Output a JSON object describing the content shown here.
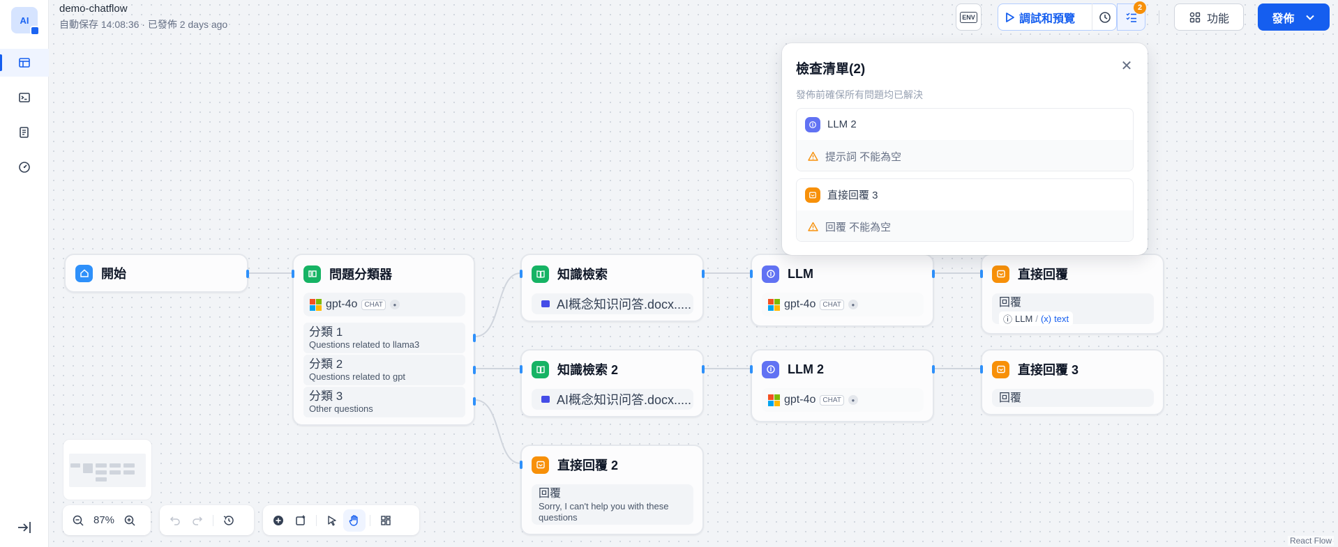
{
  "header": {
    "app_name": "demo-chatflow",
    "save_status": "自動保存 14:08:36 · 已發佈 2 days ago",
    "env_label": "ENV",
    "run_label": "調試和預覽",
    "checklist_count": "2",
    "features_label": "功能",
    "publish_label": "發佈"
  },
  "sidebar": {
    "logo_text": "AI",
    "items": [
      {
        "name": "orchestrate",
        "icon": "layout-icon"
      },
      {
        "name": "api-access",
        "icon": "terminal-icon"
      },
      {
        "name": "logs",
        "icon": "file-list-icon"
      },
      {
        "name": "monitoring",
        "icon": "dashboard-icon"
      }
    ]
  },
  "checklist": {
    "title": "檢查清單(2)",
    "subtitle": "發佈前確保所有問題均已解決",
    "issues": [
      {
        "node": "LLM 2",
        "message": "提示詞 不能為空",
        "color": "#6172f3"
      },
      {
        "node": "直接回覆 3",
        "message": "回覆 不能為空",
        "color": "#f79009"
      }
    ]
  },
  "nodes": {
    "start": {
      "title": "開始"
    },
    "classifier": {
      "title": "問題分類器",
      "model": "gpt-4o",
      "model_tag": "CHAT",
      "classes": [
        {
          "name": "分類 1",
          "desc": "Questions related to llama3"
        },
        {
          "name": "分類 2",
          "desc": "Questions related to gpt"
        },
        {
          "name": "分類 3",
          "desc": "Other questions"
        }
      ]
    },
    "kr1": {
      "title": "知識檢索",
      "dataset": "AI概念知识问答.docx....."
    },
    "kr2": {
      "title": "知識檢索 2",
      "dataset": "AI概念知识问答.docx....."
    },
    "llm1": {
      "title": "LLM",
      "model": "gpt-4o",
      "model_tag": "CHAT"
    },
    "llm2": {
      "title": "LLM 2",
      "model": "gpt-4o",
      "model_tag": "CHAT"
    },
    "answer1": {
      "title": "直接回覆",
      "label": "回覆",
      "var_node": "LLM",
      "var_sep": "/",
      "var_name": "text"
    },
    "answer2": {
      "title": "直接回覆 2",
      "label": "回覆",
      "text": "Sorry, I can't help you with these questions"
    },
    "answer3": {
      "title": "直接回覆 3",
      "label": "回覆"
    }
  },
  "controls": {
    "zoom": "87%"
  },
  "attribution": "React Flow",
  "colors": {
    "accent": "#155eef",
    "start": "#2e90fa",
    "classifier": "#16b364",
    "knowledge": "#16b364",
    "llm": "#6172f3",
    "answer": "#f79009",
    "warning": "#f79009"
  }
}
